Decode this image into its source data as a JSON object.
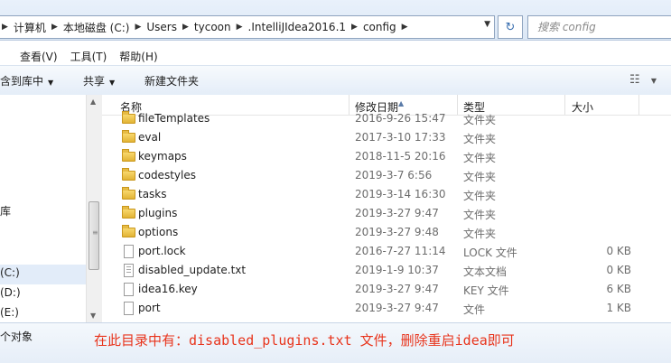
{
  "breadcrumb": [
    "计算机",
    "本地磁盘 (C:)",
    "Users",
    "tycoon",
    ".IntelliJIdea2016.1",
    "config"
  ],
  "search": {
    "placeholder": "搜索 config"
  },
  "menu": [
    "",
    "查看(V)",
    "工具(T)",
    "帮助(H)"
  ],
  "toolbar": {
    "include_library": "含到库中",
    "share": "共享",
    "new_folder": "新建文件夹"
  },
  "nav": {
    "item_a": "",
    "item_library": "库",
    "drive_c": "(C:)",
    "drive_d": "(D:)",
    "drive_e": "(E:)"
  },
  "columns": {
    "name": "名称",
    "modified": "修改日期",
    "type": "类型",
    "size": "大小"
  },
  "files": [
    {
      "name": "fileTemplates",
      "modified": "2016-9-26 15:47",
      "type": "文件夹",
      "size": "",
      "icon": "folder"
    },
    {
      "name": "eval",
      "modified": "2017-3-10 17:33",
      "type": "文件夹",
      "size": "",
      "icon": "folder"
    },
    {
      "name": "keymaps",
      "modified": "2018-11-5 20:16",
      "type": "文件夹",
      "size": "",
      "icon": "folder"
    },
    {
      "name": "codestyles",
      "modified": "2019-3-7 6:56",
      "type": "文件夹",
      "size": "",
      "icon": "folder"
    },
    {
      "name": "tasks",
      "modified": "2019-3-14 16:30",
      "type": "文件夹",
      "size": "",
      "icon": "folder"
    },
    {
      "name": "plugins",
      "modified": "2019-3-27 9:47",
      "type": "文件夹",
      "size": "",
      "icon": "folder"
    },
    {
      "name": "options",
      "modified": "2019-3-27 9:48",
      "type": "文件夹",
      "size": "",
      "icon": "folder"
    },
    {
      "name": "port.lock",
      "modified": "2016-7-27 11:14",
      "type": "LOCK 文件",
      "size": "0 KB",
      "icon": "file"
    },
    {
      "name": "disabled_update.txt",
      "modified": "2019-1-9 10:37",
      "type": "文本文档",
      "size": "0 KB",
      "icon": "text-file"
    },
    {
      "name": "idea16.key",
      "modified": "2019-3-27 9:47",
      "type": "KEY 文件",
      "size": "6 KB",
      "icon": "file"
    },
    {
      "name": "port",
      "modified": "2019-3-27 9:47",
      "type": "文件",
      "size": "1 KB",
      "icon": "file"
    }
  ],
  "status": {
    "item_count": "个对象"
  },
  "annotation": "在此目录中有：disabled_plugins.txt 文件，删除重启idea即可",
  "colors": {
    "annotation": "#e8341c",
    "folder": "#f0c94d",
    "chrome": "#dbe7f5"
  }
}
